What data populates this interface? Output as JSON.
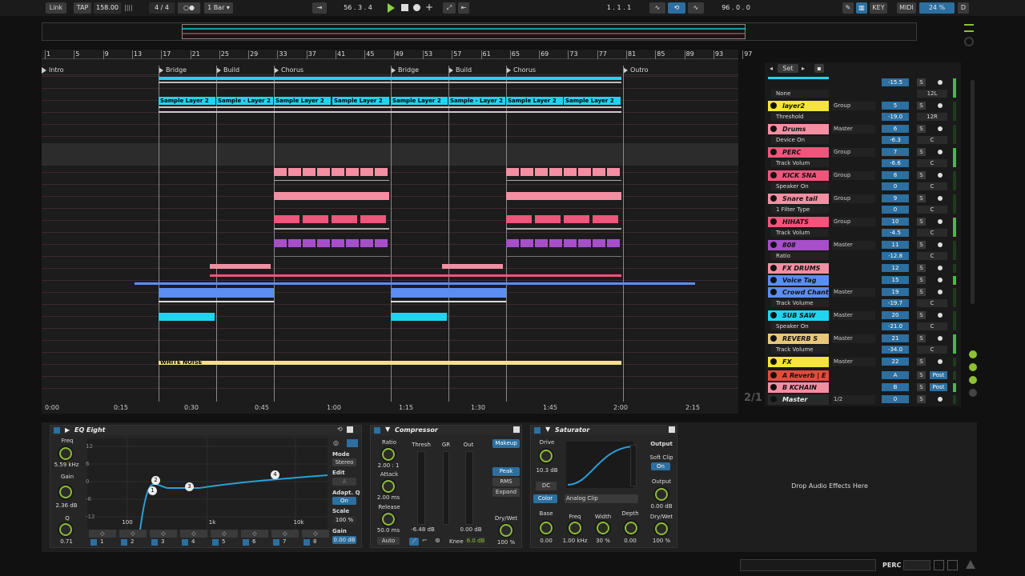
{
  "transport": {
    "link": "Link",
    "tap": "TAP",
    "tempo": "158.00",
    "meter": "4 / 4",
    "quant": "1 Bar",
    "position": "56 . 3 . 4",
    "loop_start": "1 . 1 . 1",
    "loop_len": "96 . 0 . 0",
    "key": "KEY",
    "midi": "MIDI",
    "cpu": "24 %",
    "disk": "D"
  },
  "arrangement": {
    "bars": [
      "1",
      "5",
      "9",
      "13",
      "17",
      "21",
      "25",
      "29",
      "33",
      "37",
      "41",
      "45",
      "49",
      "53",
      "57",
      "61",
      "65",
      "69",
      "73",
      "77",
      "81",
      "85",
      "89",
      "93",
      "97"
    ],
    "locators": [
      "Intro",
      "Bridge",
      "Build",
      "Chorus",
      "Bridge",
      "Build",
      "Chorus",
      "Outro"
    ],
    "clip_label": "Sample Layer 2",
    "clip_label_alt": "Sample - Layer 2",
    "white_noise": "WHITE NOISE",
    "times": [
      "0:00",
      "0:15",
      "0:30",
      "0:45",
      "1:00",
      "1:15",
      "1:30",
      "1:45",
      "2:00",
      "2:15"
    ],
    "page": "2/1"
  },
  "mixer": {
    "set": "Set",
    "tracks": [
      {
        "name": "",
        "sub": "None",
        "route": "",
        "num": "-15.5",
        "pan": "12L",
        "color": "#22d3f0"
      },
      {
        "name": "layer2",
        "sub": "Threshold",
        "route": "Group",
        "num": "5",
        "vol": "-19.0",
        "pan": "12R",
        "color": "#f5e43a"
      },
      {
        "name": "Drums",
        "sub": "Device On",
        "route": "Master",
        "num": "6",
        "vol": "-6.3",
        "pan": "C",
        "color": "#f48ea3"
      },
      {
        "name": "PERC",
        "sub": "Track Volum",
        "route": "Group",
        "num": "7",
        "vol": "-6.6",
        "pan": "C",
        "color": "#f0557c"
      },
      {
        "name": "KICK SNA",
        "sub": "Speaker On",
        "route": "Group",
        "num": "8",
        "vol": "0",
        "pan": "C",
        "color": "#f0557c"
      },
      {
        "name": "Snare tail",
        "sub": "1 Filter Type",
        "route": "Group",
        "num": "9",
        "vol": "0",
        "pan": "C",
        "color": "#f48ea3"
      },
      {
        "name": "HIHATS",
        "sub": "Track Volum",
        "route": "Group",
        "num": "10",
        "vol": "-4.5",
        "pan": "C",
        "color": "#f0557c"
      },
      {
        "name": "808",
        "sub": "Ratio",
        "route": "Master",
        "num": "11",
        "vol": "-12.8",
        "pan": "C",
        "color": "#a64fc9"
      },
      {
        "name": "FX DRUMS",
        "sub": "",
        "route": "",
        "num": "12",
        "vol": "",
        "pan": "",
        "color": "#f48ea3"
      },
      {
        "name": "Voice Tag",
        "sub": "",
        "route": "",
        "num": "15",
        "vol": "",
        "pan": "",
        "color": "#5b8ef0"
      },
      {
        "name": "Crowd Chant",
        "sub": "Track Volume",
        "route": "Master",
        "num": "19",
        "vol": "-19.7",
        "pan": "C",
        "color": "#5b8ef0"
      },
      {
        "name": "SUB SAW",
        "sub": "Speaker On",
        "route": "Master",
        "num": "20",
        "vol": "-21.0",
        "pan": "C",
        "color": "#22d3f0"
      },
      {
        "name": "REVERB S",
        "sub": "Track Volume",
        "route": "Master",
        "num": "21",
        "vol": "-34.0",
        "pan": "C",
        "color": "#e8c77a"
      },
      {
        "name": "FX",
        "sub": "",
        "route": "Master",
        "num": "22",
        "vol": "",
        "pan": "",
        "color": "#f5e43a"
      },
      {
        "name": "A Reverb | E",
        "sub": "",
        "route": "",
        "num": "A",
        "vol": "",
        "pan": "",
        "post": "Post",
        "color": "#e34b3b"
      },
      {
        "name": "B KCHAIN",
        "sub": "",
        "route": "",
        "num": "B",
        "vol": "",
        "pan": "",
        "post": "Post",
        "color": "#f48ea3"
      },
      {
        "name": "Master",
        "sub": "",
        "route": "1/2",
        "num": "0",
        "vol": "",
        "pan": "0",
        "color": "#2a2a2a"
      }
    ],
    "s_label": "S"
  },
  "devices": {
    "eq": {
      "title": "EQ Eight",
      "freq_label": "Freq",
      "freq": "5.59 kHz",
      "gain_label": "Gain",
      "gain": "2.36 dB",
      "q_label": "Q",
      "q": "0.71",
      "mode_label": "Mode",
      "mode": "Stereo",
      "edit": "Edit",
      "edit_val": "A",
      "adapt": "Adapt. Q",
      "adapt_val": "On",
      "scale_label": "Scale",
      "scale": "100 %",
      "gain2_label": "Gain",
      "gain2": "0.00 dB",
      "y_ticks": [
        "12",
        "6",
        "0",
        "-6",
        "-12"
      ],
      "x_ticks": [
        "100",
        "1k",
        "10k"
      ],
      "bands": [
        "1",
        "2",
        "3",
        "4",
        "5",
        "6",
        "7",
        "8"
      ],
      "points": [
        "1",
        "2",
        "3",
        "4"
      ]
    },
    "comp": {
      "title": "Compressor",
      "ratio_label": "Ratio",
      "ratio": "2.00 : 1",
      "attack_label": "Attack",
      "attack": "2.00 ms",
      "release_label": "Release",
      "release": "50.0 ms",
      "auto": "Auto",
      "thresh": "Thresh",
      "gr": "GR",
      "out": "Out",
      "thresh_val": "-6.48 dB",
      "out_val": "0.00 dB",
      "knee_label": "Knee",
      "knee": "6.0 dB",
      "makeup": "Makeup",
      "peak": "Peak",
      "rms": "RMS",
      "expand": "Expand",
      "drywet": "Dry/Wet",
      "drywet_val": "100 %"
    },
    "sat": {
      "title": "Saturator",
      "drive_label": "Drive",
      "drive": "10.3 dB",
      "dc": "DC",
      "color": "Color",
      "type": "Analog Clip",
      "output_head": "Output",
      "softclip": "Soft Clip",
      "softclip_val": "On",
      "output_label": "Output",
      "output": "0.00 dB",
      "base_label": "Base",
      "base": "0.00",
      "freq_label": "Freq",
      "freq": "1.00 kHz",
      "width_label": "Width",
      "width": "30 %",
      "depth_label": "Depth",
      "depth": "0.00",
      "drywet": "Dry/Wet",
      "drywet_val": "100 %"
    },
    "drop": "Drop Audio Effects Here"
  },
  "status": {
    "track": "PERC"
  },
  "colors": {
    "accent": "#2c6fa0",
    "green": "#8fbf33",
    "cyan": "#22d3f0",
    "pink": "#f48ea3",
    "hot": "#f0557c",
    "purple": "#a64fc9",
    "blue": "#5b8ef0",
    "yellow": "#f5e43a",
    "sand": "#e8c77a"
  }
}
